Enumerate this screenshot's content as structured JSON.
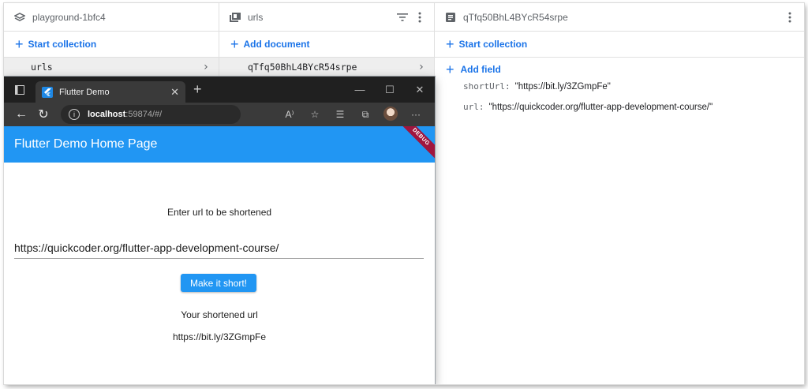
{
  "firestore": {
    "root_panel": {
      "title": "playground-1bfc4",
      "start_collection_label": "Start collection",
      "selected_collection": "urls"
    },
    "collection_panel": {
      "title": "urls",
      "add_document_label": "Add document",
      "selected_document": "qTfq50BhL4BYcR54srpe"
    },
    "document_panel": {
      "title": "qTfq50BhL4BYcR54srpe",
      "start_collection_label": "Start collection",
      "add_field_label": "Add field",
      "fields": [
        {
          "key": "shortUrl:",
          "value": "\"https://bit.ly/3ZGmpFe\""
        },
        {
          "key": "url:",
          "value": "\"https://quickcoder.org/flutter-app-development-course/\""
        }
      ]
    }
  },
  "browser": {
    "tab_title": "Flutter Demo",
    "address_host": "localhost",
    "address_rest": ":59874/#/",
    "app": {
      "appbar_title": "Flutter Demo Home Page",
      "debug_banner": "DEBUG",
      "prompt": "Enter url to be shortened",
      "input_value": "https://quickcoder.org/flutter-app-development-course/",
      "button_label": "Make it short!",
      "result_label": "Your shortened url",
      "result_value": "https://bit.ly/3ZGmpFe"
    }
  },
  "colors": {
    "firestore_accent": "#1a73e8",
    "flutter_blue": "#2196f3",
    "debug_banner": "#a0153e",
    "browser_dark": "#202020"
  }
}
